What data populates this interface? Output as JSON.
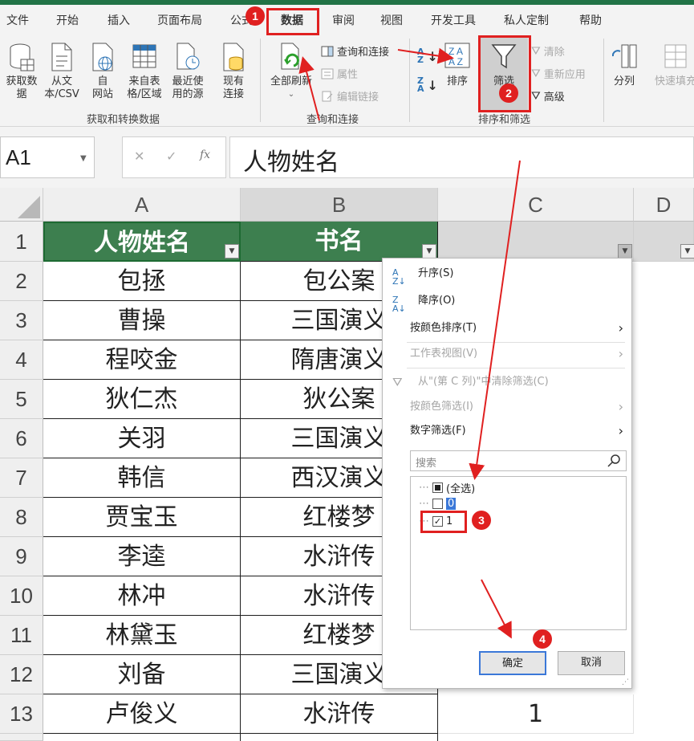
{
  "ribbon": {
    "tabs": [
      "文件",
      "开始",
      "插入",
      "页面布局",
      "公式",
      "数据",
      "审阅",
      "视图",
      "开发工具",
      "私人定制",
      "帮助"
    ],
    "get_data": {
      "get_data_label": "获取数\n据",
      "from_text_label": "从文\n本/CSV",
      "from_web_label": "自\n网站",
      "from_table_label": "来自表\n格/区域",
      "recent_sources_label": "最近使\n用的源",
      "existing_conn_label": "现有\n连接",
      "group_label": "获取和转换数据"
    },
    "queries": {
      "refresh_all_label": "全部刷新",
      "queries_conn_label": "查询和连接",
      "properties_label": "属性",
      "edit_links_label": "编辑链接",
      "group_label": "查询和连接"
    },
    "sort_filter": {
      "sort_label": "排序",
      "filter_label": "筛选",
      "clear_label": "清除",
      "reapply_label": "重新应用",
      "advanced_label": "高级",
      "group_label": "排序和筛选"
    },
    "data_tools": {
      "text_to_columns_label": "分列",
      "flash_fill_label": "快速填充"
    }
  },
  "formula_bar": {
    "name_box": "A1",
    "fx": "fx",
    "cancel": "✕",
    "enter": "✓",
    "content": "人物姓名"
  },
  "sheet": {
    "columns": [
      "A",
      "B",
      "C",
      "D"
    ],
    "rows": [
      "1",
      "2",
      "3",
      "4",
      "5",
      "6",
      "7",
      "8",
      "9",
      "10",
      "11",
      "12",
      "13"
    ],
    "header": {
      "a": "人物姓名",
      "b": "书名"
    },
    "data": [
      {
        "a": "包拯",
        "b": "包公案",
        "c": ""
      },
      {
        "a": "曹操",
        "b": "三国演义",
        "c": ""
      },
      {
        "a": "程咬金",
        "b": "隋唐演义",
        "c": ""
      },
      {
        "a": "狄仁杰",
        "b": "狄公案",
        "c": ""
      },
      {
        "a": "关羽",
        "b": "三国演义",
        "c": ""
      },
      {
        "a": "韩信",
        "b": "西汉演义",
        "c": ""
      },
      {
        "a": "贾宝玉",
        "b": "红楼梦",
        "c": ""
      },
      {
        "a": "李逵",
        "b": "水浒传",
        "c": ""
      },
      {
        "a": "林冲",
        "b": "水浒传",
        "c": ""
      },
      {
        "a": "林黛玉",
        "b": "红楼梦",
        "c": ""
      },
      {
        "a": "刘备",
        "b": "三国演义",
        "c": ""
      },
      {
        "a": "卢俊义",
        "b": "水浒传",
        "c": "1"
      }
    ]
  },
  "filter_panel": {
    "sort_asc": "升序(S)",
    "sort_desc": "降序(O)",
    "sort_by_color": "按颜色排序(T)",
    "sheet_view": "工作表视图(V)",
    "clear_filter": "从\"(第 C 列)\"中清除筛选(C)",
    "filter_by_color": "按颜色筛选(I)",
    "number_filters": "数字筛选(F)",
    "search_placeholder": "搜索",
    "items": [
      {
        "label": "(全选)",
        "state": "partial"
      },
      {
        "label": "0",
        "state": "unchecked"
      },
      {
        "label": "1",
        "state": "checked"
      }
    ],
    "ok": "确定",
    "cancel": "取消"
  },
  "annotations": {
    "badges": [
      "1",
      "2",
      "3",
      "4"
    ],
    "color": "#e02020"
  },
  "colors": {
    "excel_green": "#217346",
    "header_fill": "#3d7f4f"
  }
}
